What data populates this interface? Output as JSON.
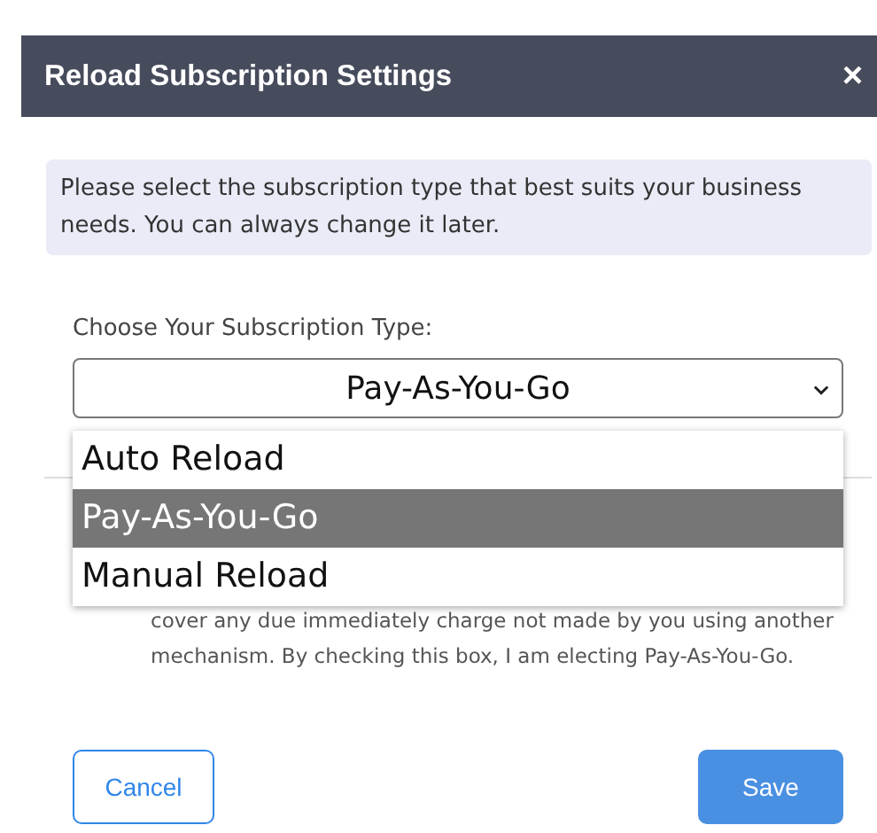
{
  "dialog": {
    "title": "Reload Subscription Settings",
    "close": "×"
  },
  "info": "Please select the subscription type that best suits your business needs. You can always change it later.",
  "subscription": {
    "label": "Choose Your Subscription Type:",
    "value": "Pay-As-You-Go",
    "expanded": true,
    "options": [
      {
        "label": "Auto Reload",
        "selected": false
      },
      {
        "label": "Pay-As-You-Go",
        "selected": true
      },
      {
        "label": "Manual Reload",
        "selected": false
      }
    ]
  },
  "terms": "cover any due immediately charge not made by you using another mechanism. By checking this box, I am electing Pay-As-You-Go.",
  "buttons": [
    {
      "label": "Cancel",
      "kind": "secondary"
    },
    {
      "label": "Save",
      "kind": "primary"
    }
  ]
}
